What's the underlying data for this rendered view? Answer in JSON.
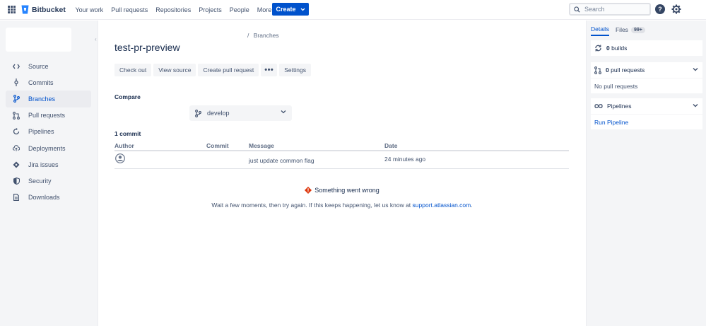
{
  "app": {
    "name": "Bitbucket"
  },
  "topnav": {
    "items": [
      "Your work",
      "Pull requests",
      "Repositories",
      "Projects",
      "People",
      "More"
    ],
    "create_label": "Create",
    "search_placeholder": "Search",
    "help_symbol": "?"
  },
  "sidebar": {
    "items": [
      {
        "label": "Source",
        "icon": "code-icon"
      },
      {
        "label": "Commits",
        "icon": "commit-icon"
      },
      {
        "label": "Branches",
        "icon": "branch-icon",
        "active": true
      },
      {
        "label": "Pull requests",
        "icon": "pull-request-icon"
      },
      {
        "label": "Pipelines",
        "icon": "pipelines-icon"
      },
      {
        "label": "Deployments",
        "icon": "cloud-upload-icon"
      },
      {
        "label": "Jira issues",
        "icon": "jira-icon"
      },
      {
        "label": "Security",
        "icon": "shield-icon"
      },
      {
        "label": "Downloads",
        "icon": "document-icon"
      }
    ]
  },
  "main": {
    "breadcrumb_sep": "/",
    "breadcrumb_current": "Branches",
    "title": "test-pr-preview",
    "actions": {
      "checkout": "Check out",
      "view_source": "View source",
      "create_pr": "Create pull request",
      "more": "•••",
      "settings": "Settings"
    },
    "compare_label": "Compare",
    "branch": "develop",
    "commit_count": "1 commit",
    "table": {
      "headers": {
        "author": "Author",
        "commit": "Commit",
        "message": "Message",
        "date": "Date"
      },
      "rows": [
        {
          "author": "",
          "commit": "",
          "message": "just update common flag",
          "date": "24 minutes ago"
        }
      ]
    },
    "error": {
      "title": "Something went wrong",
      "message": "Wait a few moments, then try again. If this keeps happening, let us know at",
      "link": "support.atlassian.com",
      "end": "."
    }
  },
  "right_panel": {
    "tabs": {
      "details": "Details",
      "files": "Files",
      "files_badge": "99+"
    },
    "builds_count": "0",
    "builds_label": "builds",
    "prs_count": "0",
    "prs_label": "pull requests",
    "no_prs": "No pull requests",
    "pipelines_label": "Pipelines",
    "run_pipeline": "Run Pipeline"
  },
  "colors": {
    "primary": "#0052cc",
    "sidebar_bg": "#f4f5f7",
    "error": "#de350b"
  }
}
